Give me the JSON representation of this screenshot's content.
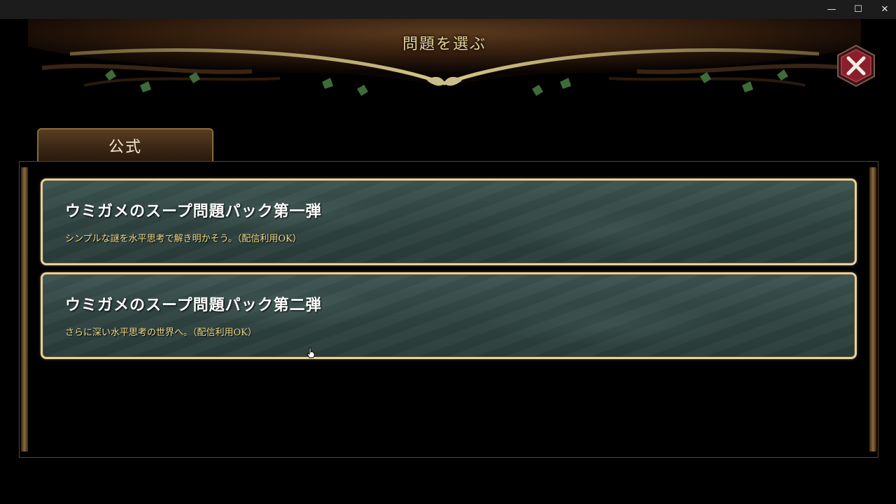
{
  "window": {
    "minimize_glyph": "—",
    "maximize_glyph": "☐",
    "close_glyph": "✕"
  },
  "header": {
    "title": "問題を選ぶ"
  },
  "close_button": {
    "icon": "close-x-icon"
  },
  "tabs": [
    {
      "label": "公式",
      "active": true
    }
  ],
  "packs": [
    {
      "title": "ウミガメのスープ問題パック第一弾",
      "description": "シンプルな謎を水平思考で解き明かそう。（配信利用OK）"
    },
    {
      "title": "ウミガメのスープ問題パック第二弾",
      "description": "さらに深い水平思考の世界へ。（配信利用OK）"
    }
  ],
  "colors": {
    "gold_text": "#e8d79a",
    "pack_border": "#e4d2a0",
    "pack_bg": "#2f4340",
    "desc_text": "#f0dc8a",
    "close_button_red": "#8a1e2a"
  }
}
